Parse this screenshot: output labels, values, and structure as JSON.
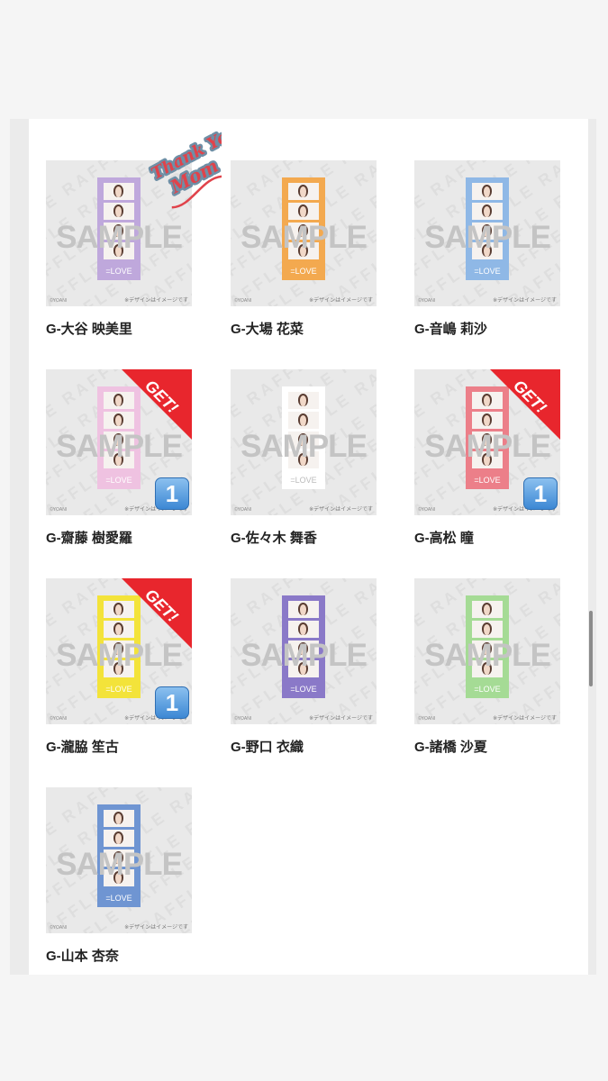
{
  "grid": {
    "items": [
      {
        "name": "G-大谷 映美里",
        "strip_color": "#bfa8dc",
        "get": false,
        "count": "",
        "badge": false
      },
      {
        "name": "G-大場 花菜",
        "strip_color": "#f3a94f",
        "get": false,
        "count": "",
        "badge": false
      },
      {
        "name": "G-音嶋 莉沙",
        "strip_color": "#8fb8e6",
        "get": false,
        "count": "",
        "badge": false
      },
      {
        "name": "G-齋藤 樹愛羅",
        "strip_color": "#efc2e1",
        "get": true,
        "count": "1",
        "badge": true
      },
      {
        "name": "G-佐々木 舞香",
        "strip_color": "#ffffff",
        "get": false,
        "count": "",
        "badge": false
      },
      {
        "name": "G-高松 瞳",
        "strip_color": "#ec7f89",
        "get": true,
        "count": "1",
        "badge": true
      },
      {
        "name": "G-瀧脇 笙古",
        "strip_color": "#f3e33a",
        "get": true,
        "count": "1",
        "badge": true
      },
      {
        "name": "G-野口 衣織",
        "strip_color": "#8a79c8",
        "get": false,
        "count": "",
        "badge": false
      },
      {
        "name": "G-諸橋 沙夏",
        "strip_color": "#a5db95",
        "get": false,
        "count": "",
        "badge": false
      },
      {
        "name": "G-山本 杏奈",
        "strip_color": "#6f95d2",
        "get": false,
        "count": "",
        "badge": false
      }
    ],
    "watermark": "SAMPLE",
    "background_text": "RAFFLE",
    "copyright": "©YOANI",
    "disclaimer": "※デザインはイメージです",
    "strip_label": "=LOVE",
    "get_label": "GET!"
  },
  "sticker": {
    "line1": "Thank You",
    "line2": "Mom",
    "color": "#e0434b"
  },
  "colors": {
    "ribbon": "#e8262d",
    "badge": "#3d88d4",
    "text": "#222222"
  }
}
